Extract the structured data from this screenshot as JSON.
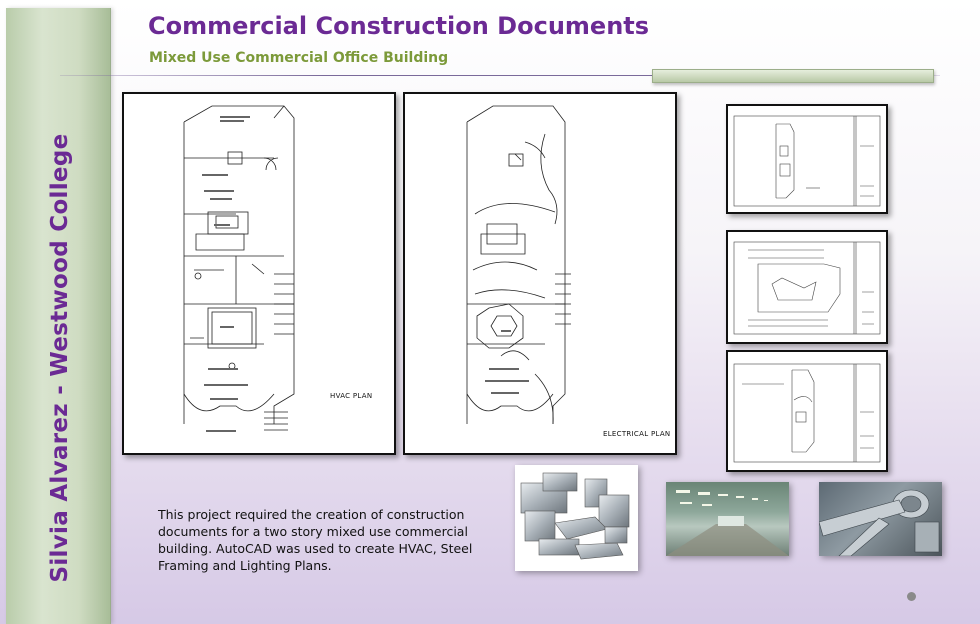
{
  "sidebar": {
    "author": "Silvia Alvarez - Westwood College"
  },
  "header": {
    "title": "Commercial Construction Documents",
    "subtitle": "Mixed Use Commercial Office Building"
  },
  "plans": [
    {
      "label": "HVAC PLAN"
    },
    {
      "label": "ELECTRICAL PLAN"
    }
  ],
  "description": "This project required the creation of construction documents for a two story mixed use commercial building. AutoCAD was used to create HVAC, Steel Framing and Lighting Plans.",
  "icons": {
    "slide_indicator": "dot-icon"
  }
}
